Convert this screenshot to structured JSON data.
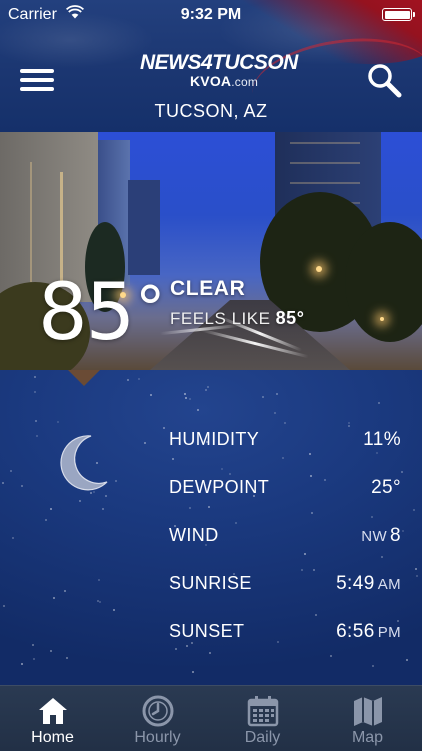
{
  "status_bar": {
    "carrier": "Carrier",
    "time": "9:32 PM"
  },
  "header": {
    "logo_brand": "NEWS4TUCSON",
    "logo_sub": "KVOA",
    "logo_sub_suffix": ".com",
    "location": "TUCSON, AZ",
    "colors": {
      "brand_blue": "#1b3671",
      "brand_red": "#c0131f"
    }
  },
  "current": {
    "temperature": "85",
    "degree_symbol": "°",
    "condition": "CLEAR",
    "feels_like_label": "FEELS LIKE",
    "feels_like_value": "85°"
  },
  "details": {
    "icon": "moon-icon",
    "rows": [
      {
        "label": "HUMIDITY",
        "value": "11%"
      },
      {
        "label": "DEWPOINT",
        "value": "25°"
      },
      {
        "label": "WIND",
        "direction": "NW",
        "value": "8"
      },
      {
        "label": "SUNRISE",
        "value": "5:49",
        "unit": "AM"
      },
      {
        "label": "SUNSET",
        "value": "6:56",
        "unit": "PM"
      }
    ]
  },
  "tabs": [
    {
      "label": "Home",
      "icon": "home-icon",
      "active": true
    },
    {
      "label": "Hourly",
      "icon": "clock-icon",
      "active": false
    },
    {
      "label": "Daily",
      "icon": "calendar-icon",
      "active": false
    },
    {
      "label": "Map",
      "icon": "map-icon",
      "active": false
    }
  ]
}
